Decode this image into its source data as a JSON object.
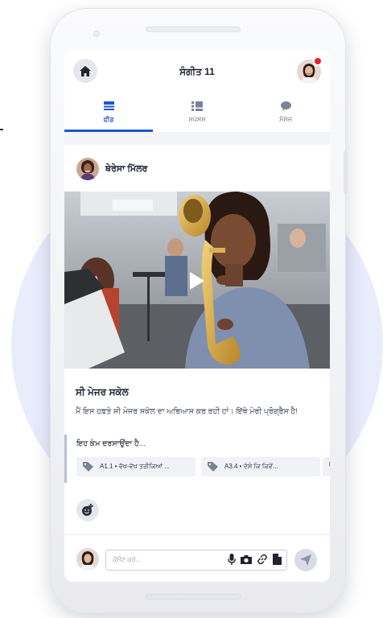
{
  "header": {
    "title": "ਸੰਗੀਤ 11"
  },
  "tabs": [
    {
      "label": "ਫੀਡ",
      "icon": "feed-icon",
      "active": true
    },
    {
      "label": "ਸਪੇਸਸ",
      "icon": "spaces-icon",
      "active": false
    },
    {
      "label": "ਮੈਸੇਜ",
      "icon": "message-icon",
      "active": false
    }
  ],
  "post": {
    "author": "ਥੇਰੇਸਾ ਮਿੱਲਰ",
    "media_type": "video",
    "title": "ਸੀ ਮੇਜਰ ਸਕੇਲ",
    "body": "ਮੈਂ ਇਸ ਹਫ਼ਤੇ ਸੀ ਮੇਜਰ ਸਕੇਲ ਦਾ ਅਭਿਆਸ ਕਰ ਰਹੀ ਹਾਂ। ਇੱਥੇ ਮੇਰੀ ਪ੍ਰੋਗ੍ਰੈਸ ਹੈ!",
    "shows_label": "ਇਹ ਕੰਮ ਦਰਸਾਉਂਦਾ ਹੈ...",
    "chips": [
      {
        "label": "A1.1 • ਵੱਖ-ਵੱਖ ਤਰੀਕਿਆਂ ..."
      },
      {
        "label": "A3.4 • ਦੱਸੋ ਕਿ ਕਿਵੇਂ..."
      }
    ]
  },
  "comment": {
    "placeholder": "ਕੋਮੈਂਟ ਕਰੋ..."
  },
  "colors": {
    "accent": "#1b57c9",
    "notification": "#e8212b",
    "background_circle": "#e9ecfb"
  }
}
